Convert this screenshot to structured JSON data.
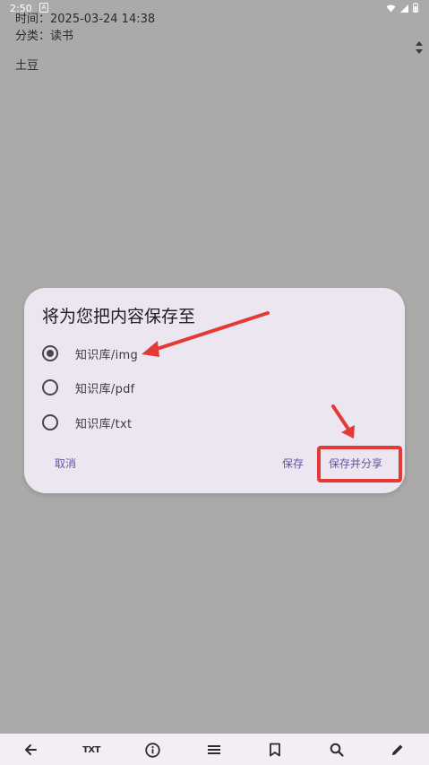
{
  "status_bar": {
    "time": "2:50"
  },
  "note": {
    "time_line": "时间：2025-03-24 14:38",
    "category_line": "分类：读书",
    "content": "土豆"
  },
  "dialog": {
    "title": "将为您把内容保存至",
    "options": [
      {
        "label": "知识库/img",
        "selected": true
      },
      {
        "label": "知识库/pdf",
        "selected": false
      },
      {
        "label": "知识库/txt",
        "selected": false
      }
    ],
    "buttons": {
      "cancel": "取消",
      "save": "保存",
      "save_share": "保存并分享"
    }
  },
  "bottom_bar": {
    "txt_label": "TXT"
  },
  "colors": {
    "accent": "#6750a4",
    "annotation": "#e53935",
    "scrim": "#aaaaaa",
    "dialog_bg": "#ece6f0"
  },
  "icons": [
    "back-arrow-icon",
    "txt-icon",
    "info-icon",
    "menu-icon",
    "bookmark-icon",
    "search-icon",
    "edit-icon"
  ]
}
